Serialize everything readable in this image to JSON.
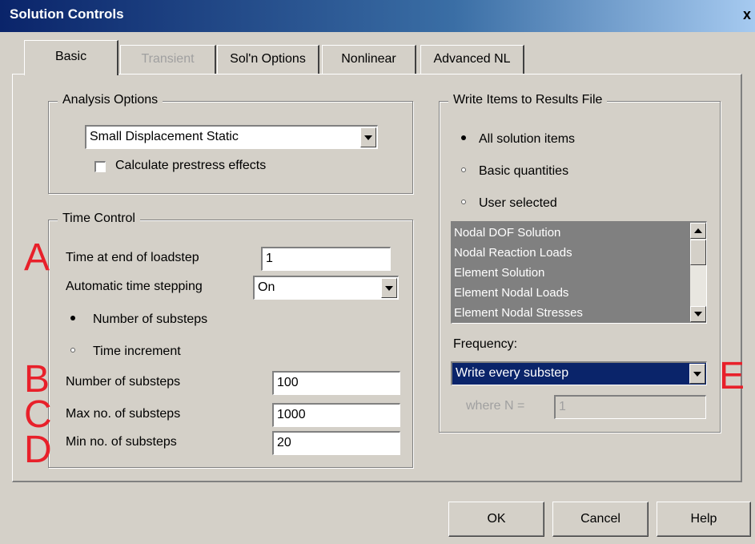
{
  "window": {
    "title": "Solution Controls",
    "close": "x"
  },
  "tabs": [
    {
      "label": "Basic"
    },
    {
      "label": "Transient"
    },
    {
      "label": "Sol'n Options"
    },
    {
      "label": "Nonlinear"
    },
    {
      "label": "Advanced NL"
    }
  ],
  "analysis": {
    "group_label": "Analysis Options",
    "type_value": "Small Displacement Static",
    "prestress_label": "Calculate prestress effects"
  },
  "time_control": {
    "group_label": "Time Control",
    "end_time_label": "Time at end of loadstep",
    "end_time_value": "1",
    "auto_step_label": "Automatic time stepping",
    "auto_step_value": "On",
    "radio_substeps_label": "Number of substeps",
    "radio_increment_label": "Time increment",
    "num_substeps_label": "Number of substeps",
    "num_substeps_value": "100",
    "max_substeps_label": "Max no. of substeps",
    "max_substeps_value": "1000",
    "min_substeps_label": "Min no. of substeps",
    "min_substeps_value": "20"
  },
  "write_items": {
    "group_label": "Write Items to Results File",
    "radio_all": "All solution items",
    "radio_basic": "Basic quantities",
    "radio_user": "User selected",
    "list_items": [
      "Nodal DOF Solution",
      "Nodal Reaction Loads",
      "Element Solution",
      "Element Nodal Loads",
      "Element Nodal Stresses"
    ],
    "frequency_label": "Frequency:",
    "frequency_value": "Write every substep",
    "where_n_label": "where N =",
    "where_n_value": "1"
  },
  "annotations": {
    "a": "A",
    "b": "B",
    "c": "C",
    "d": "D",
    "e": "E"
  },
  "buttons": {
    "ok": "OK",
    "cancel": "Cancel",
    "help": "Help"
  },
  "colors": {
    "title_bar": "#0a246a",
    "annotation": "#e8202a",
    "selection": "#0a246a",
    "dialog": "#d4d0c8"
  }
}
